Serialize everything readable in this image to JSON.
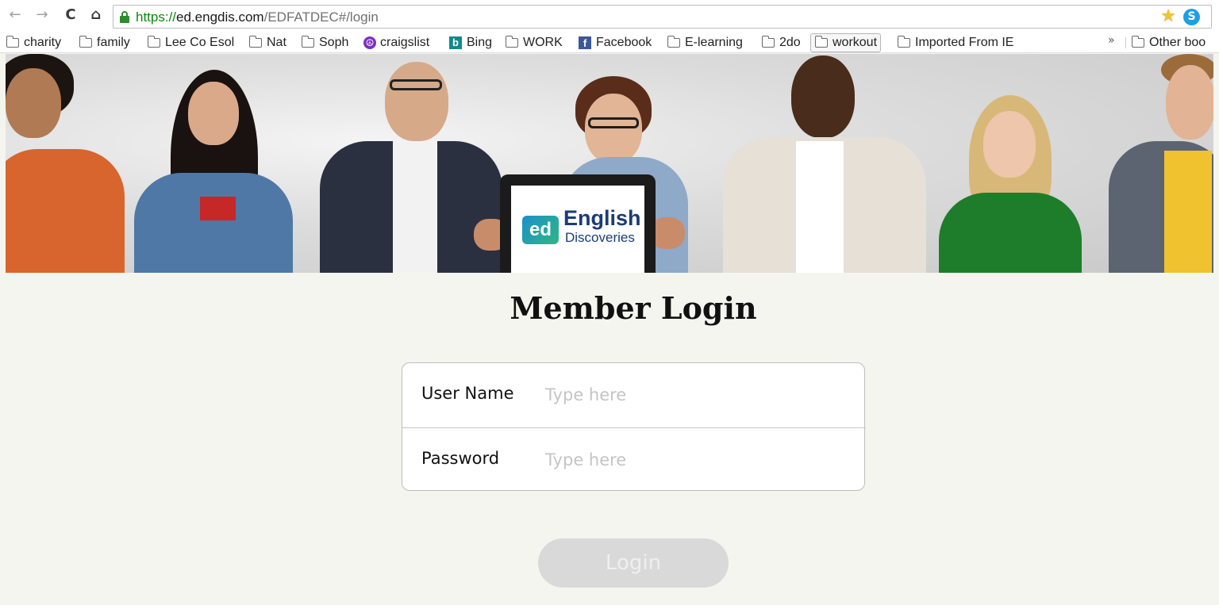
{
  "browser": {
    "url_scheme": "https://",
    "url_host": "ed.engdis.com",
    "url_path": "/EDFATDEC#/login",
    "skype_glyph": "S",
    "bookmarks": [
      {
        "label": "charity",
        "icon": "folder-icon"
      },
      {
        "label": "family",
        "icon": "folder-icon"
      },
      {
        "label": "Lee Co Esol",
        "icon": "folder-icon"
      },
      {
        "label": "Nat",
        "icon": "folder-icon"
      },
      {
        "label": "Soph",
        "icon": "folder-icon"
      },
      {
        "label": "craigslist",
        "icon": "peace-icon"
      },
      {
        "label": "Bing",
        "icon": "bing-icon"
      },
      {
        "label": "WORK",
        "icon": "folder-icon"
      },
      {
        "label": "Facebook",
        "icon": "facebook-icon"
      },
      {
        "label": "E-learning",
        "icon": "folder-icon"
      },
      {
        "label": "2do",
        "icon": "folder-icon"
      },
      {
        "label": "workout",
        "icon": "folder-icon"
      },
      {
        "label": "Imported From IE",
        "icon": "folder-icon"
      }
    ],
    "overflow_label": "»",
    "other_bookmarks": "Other boo"
  },
  "banner": {
    "badge": "ed",
    "brand_line1": "English",
    "brand_line2": "Discoveries"
  },
  "login": {
    "title": "Member Login",
    "username_label": "User Name",
    "username_placeholder": "Type here",
    "password_label": "Password",
    "password_placeholder": "Type here",
    "button_label": "Login"
  },
  "colors": {
    "page_bg": "#f5f5f0",
    "brand_navy": "#1a3c78",
    "button_disabled": "#d9d9d9"
  }
}
